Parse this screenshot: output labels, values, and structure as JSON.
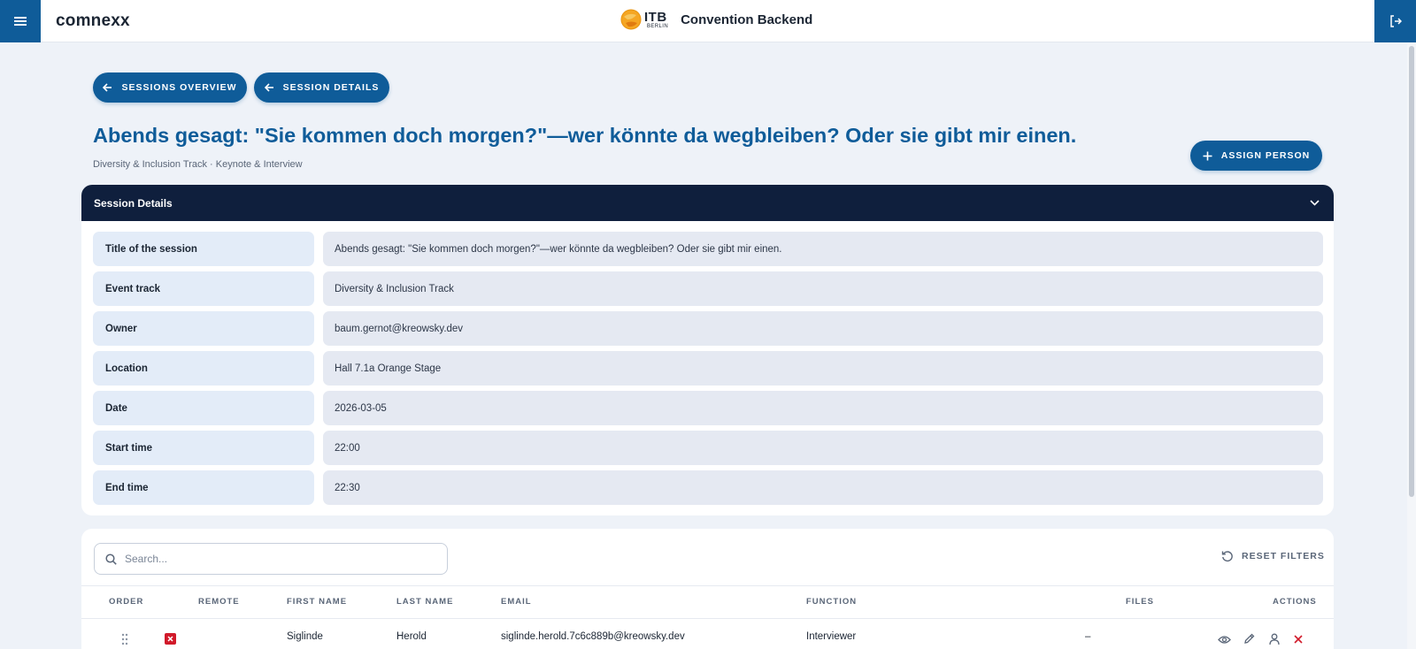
{
  "topbar": {
    "brand": "comnexx",
    "logo_big": "ITB",
    "logo_small": "BERLIN",
    "app_title": "Convention Backend"
  },
  "nav": {
    "back_overview_label": "SESSIONS OVERVIEW",
    "back_details_label": "SESSION DETAILS"
  },
  "header": {
    "title": "Abends gesagt: \"Sie kommen doch morgen?\"—wer könnte da wegbleiben? Oder sie gibt mir einen.",
    "subtitle": "Diversity & Inclusion Track · Keynote & Interview",
    "assign_label": "ASSIGN PERSON"
  },
  "details": {
    "section_label": "Session Details",
    "rows": [
      {
        "key": "Title of the session",
        "value": "Abends gesagt: \"Sie kommen doch morgen?\"—wer könnte da wegbleiben? Oder sie gibt mir einen."
      },
      {
        "key": "Event track",
        "value": "Diversity & Inclusion Track"
      },
      {
        "key": "Owner",
        "value": "baum.gernot@kreowsky.dev"
      },
      {
        "key": "Location",
        "value": "Hall 7.1a Orange Stage"
      },
      {
        "key": "Date",
        "value": "2026-03-05"
      },
      {
        "key": "Start time",
        "value": "22:00"
      },
      {
        "key": "End time",
        "value": "22:30"
      }
    ]
  },
  "persons": {
    "search_placeholder": "Search...",
    "reset_label": "RESET FILTERS",
    "columns": [
      "ORDER",
      "REMOTE",
      "FIRST NAME",
      "LAST NAME",
      "EMAIL",
      "FUNCTION",
      "FILES",
      "ACTIONS"
    ],
    "rows": [
      {
        "first_name": "Siglinde",
        "last_name": "Herold",
        "email": "siglinde.herold.7c6c889b@kreowsky.dev",
        "function": "Interviewer",
        "files": "–",
        "remote": false
      }
    ]
  },
  "colors": {
    "primary": "#0f5c99",
    "header_dark": "#0f1f3d",
    "danger": "#d11a2a",
    "background": "#eef2f8"
  }
}
